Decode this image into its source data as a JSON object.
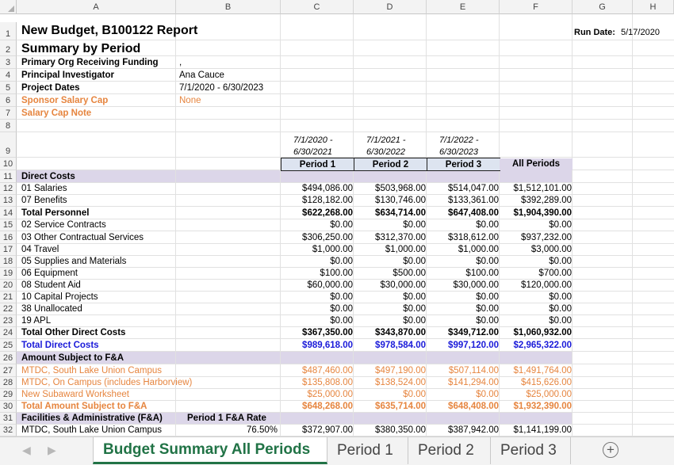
{
  "columns": [
    "A",
    "B",
    "C",
    "D",
    "E",
    "F",
    "G",
    "H"
  ],
  "rows": [
    "1",
    "2",
    "3",
    "4",
    "5",
    "6",
    "7",
    "8",
    "9",
    "10",
    "11",
    "12",
    "13",
    "14",
    "15",
    "16",
    "17",
    "18",
    "19",
    "20",
    "21",
    "22",
    "23",
    "24",
    "25",
    "26",
    "27",
    "28",
    "29",
    "30",
    "31",
    "32"
  ],
  "header": {
    "title": "New Budget, B100122 Report",
    "subtitle": "Summary by Period",
    "run_date_label": "Run Date:",
    "run_date": "5/17/2020",
    "primary_org_label": "Primary Org Receiving Funding",
    "primary_org_value": ",",
    "pi_label": "Principal Investigator",
    "pi_value": "Ana Cauce",
    "dates_label": "Project Dates",
    "dates_value": "7/1/2020 - 6/30/2023",
    "cap_label": "Sponsor Salary Cap",
    "cap_value": "None",
    "cap_note_label": "Salary Cap Note"
  },
  "periods": {
    "ranges": [
      [
        "7/1/2020 -",
        "6/30/2021"
      ],
      [
        "7/1/2021 -",
        "6/30/2022"
      ],
      [
        "7/1/2022 -",
        "6/30/2023"
      ]
    ],
    "labels": [
      "Period 1",
      "Period 2",
      "Period 3",
      "All Periods"
    ]
  },
  "sections": {
    "direct_costs": "Direct Costs",
    "amount_subject": "Amount Subject to F&A",
    "fa": "Facilities & Administrative (F&A)",
    "fa_rate_label": "Period 1 F&A Rate"
  },
  "table": [
    {
      "row": 12,
      "label": "01 Salaries",
      "values": [
        "$494,086.00",
        "$503,968.00",
        "$514,047.00",
        "$1,512,101.00"
      ],
      "style": ""
    },
    {
      "row": 13,
      "label": "07 Benefits",
      "values": [
        "$128,182.00",
        "$130,746.00",
        "$133,361.00",
        "$392,289.00"
      ],
      "style": ""
    },
    {
      "row": 14,
      "label": "Total Personnel",
      "values": [
        "$622,268.00",
        "$634,714.00",
        "$647,408.00",
        "$1,904,390.00"
      ],
      "style": "b"
    },
    {
      "row": 15,
      "label": "02 Service Contracts",
      "values": [
        "$0.00",
        "$0.00",
        "$0.00",
        "$0.00"
      ],
      "style": ""
    },
    {
      "row": 16,
      "label": "03 Other Contractual Services",
      "values": [
        "$306,250.00",
        "$312,370.00",
        "$318,612.00",
        "$937,232.00"
      ],
      "style": ""
    },
    {
      "row": 17,
      "label": "04 Travel",
      "values": [
        "$1,000.00",
        "$1,000.00",
        "$1,000.00",
        "$3,000.00"
      ],
      "style": ""
    },
    {
      "row": 18,
      "label": "05 Supplies and Materials",
      "values": [
        "$0.00",
        "$0.00",
        "$0.00",
        "$0.00"
      ],
      "style": ""
    },
    {
      "row": 19,
      "label": "06 Equipment",
      "values": [
        "$100.00",
        "$500.00",
        "$100.00",
        "$700.00"
      ],
      "style": ""
    },
    {
      "row": 20,
      "label": "08 Student Aid",
      "values": [
        "$60,000.00",
        "$30,000.00",
        "$30,000.00",
        "$120,000.00"
      ],
      "style": ""
    },
    {
      "row": 21,
      "label": "10 Capital Projects",
      "values": [
        "$0.00",
        "$0.00",
        "$0.00",
        "$0.00"
      ],
      "style": ""
    },
    {
      "row": 22,
      "label": "38 Unallocated",
      "values": [
        "$0.00",
        "$0.00",
        "$0.00",
        "$0.00"
      ],
      "style": ""
    },
    {
      "row": 23,
      "label": "19 APL",
      "values": [
        "$0.00",
        "$0.00",
        "$0.00",
        "$0.00"
      ],
      "style": ""
    },
    {
      "row": 24,
      "label": "Total Other Direct Costs",
      "values": [
        "$367,350.00",
        "$343,870.00",
        "$349,712.00",
        "$1,060,932.00"
      ],
      "style": "b"
    },
    {
      "row": 25,
      "label": "Total Direct Costs",
      "values": [
        "$989,618.00",
        "$978,584.00",
        "$997,120.00",
        "$2,965,322.00"
      ],
      "style": "b blue",
      "label_style": "blue"
    },
    {
      "row": 27,
      "label": "MTDC, South Lake Union Campus",
      "values": [
        "$487,460.00",
        "$497,190.00",
        "$507,114.00",
        "$1,491,764.00"
      ],
      "style": "orange"
    },
    {
      "row": 28,
      "label": "MTDC, On Campus (includes Harborview)",
      "values": [
        "$135,808.00",
        "$138,524.00",
        "$141,294.00",
        "$415,626.00"
      ],
      "style": "orange"
    },
    {
      "row": 29,
      "label": "New Subaward Worksheet",
      "values": [
        "$25,000.00",
        "$0.00",
        "$0.00",
        "$25,000.00"
      ],
      "style": "orange"
    },
    {
      "row": 30,
      "label": "Total Amount Subject to F&A",
      "values": [
        "$648,268.00",
        "$635,714.00",
        "$648,408.00",
        "$1,932,390.00"
      ],
      "style": "b orange"
    },
    {
      "row": 32,
      "label": "MTDC, South Lake Union Campus",
      "rate": "76.50%",
      "values": [
        "$372,907.00",
        "$380,350.00",
        "$387,942.00",
        "$1,141,199.00"
      ],
      "style": ""
    }
  ],
  "tabs": [
    "Budget Summary All Periods",
    "Period 1",
    "Period 2",
    "Period 3"
  ],
  "colors": {
    "accent": "#217346",
    "band": "#dcd6e9",
    "orange": "#e6853f",
    "blue": "#1a1ad9",
    "period_box": "#dde4f0"
  }
}
